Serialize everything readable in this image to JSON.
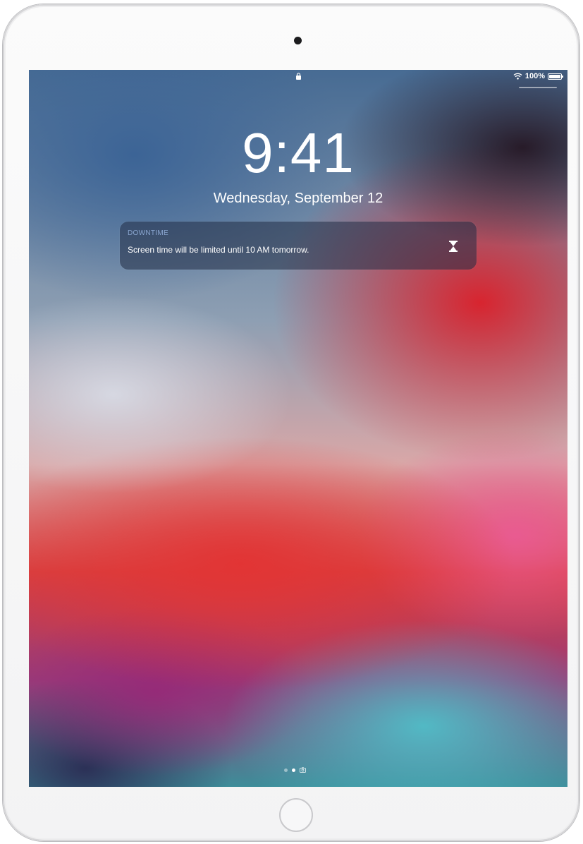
{
  "status_bar": {
    "battery_text": "100%",
    "battery_level": 1.0,
    "icons": [
      "lock-icon",
      "wifi-icon",
      "battery-icon"
    ]
  },
  "lock_screen": {
    "time": "9:41",
    "date": "Wednesday, September 12"
  },
  "notification": {
    "app_name": "DOWNTIME",
    "message": "Screen time will be limited until 10 AM tomorrow.",
    "icon": "hourglass-icon"
  },
  "page_indicator": {
    "pages": 2,
    "current": 2,
    "trailing_icon": "camera-icon"
  },
  "colors": {
    "notification_app_label": "#8aa6d0",
    "text": "#ffffff"
  }
}
